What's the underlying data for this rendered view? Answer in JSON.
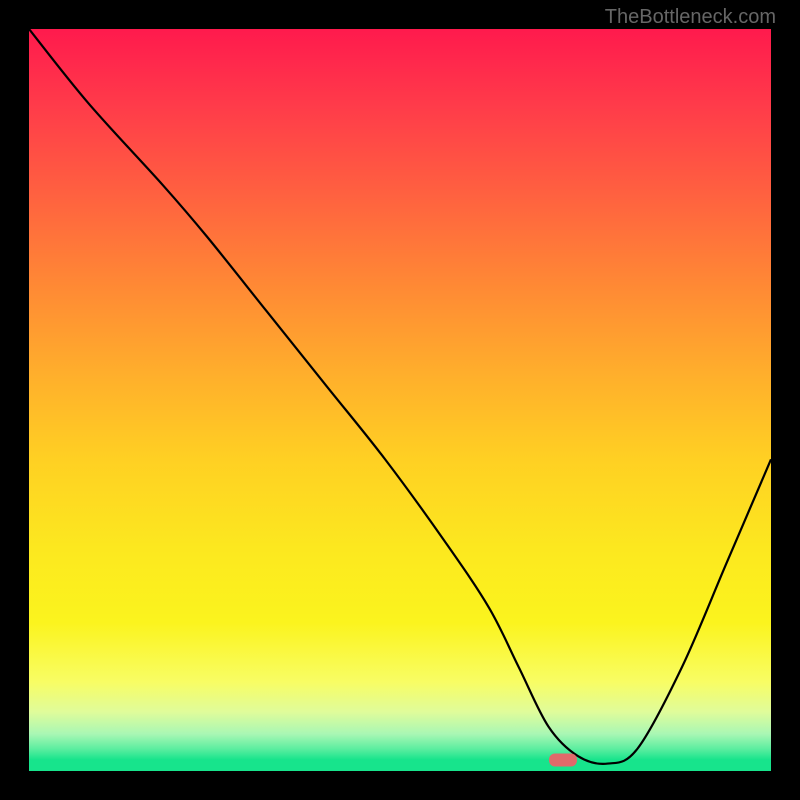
{
  "watermark": "TheBottleneck.com",
  "chart_data": {
    "type": "line",
    "title": "",
    "xlabel": "",
    "ylabel": "",
    "xlim": [
      0,
      100
    ],
    "ylim": [
      0,
      100
    ],
    "grid": false,
    "legend": false,
    "gradient": {
      "top_color": "#ff1a4d",
      "mid_color": "#ffd023",
      "bottom_color": "#17e48c"
    },
    "series": [
      {
        "name": "curve",
        "x": [
          0,
          8,
          18,
          24,
          32,
          40,
          48,
          56,
          62,
          66,
          70,
          74,
          78,
          82,
          88,
          94,
          100
        ],
        "values": [
          100,
          90,
          79,
          72,
          62,
          52,
          42,
          31,
          22,
          14,
          6,
          2,
          1,
          3,
          14,
          28,
          42
        ]
      }
    ],
    "marker": {
      "x": 72,
      "y": 1.5,
      "color": "#e06a6a"
    }
  }
}
